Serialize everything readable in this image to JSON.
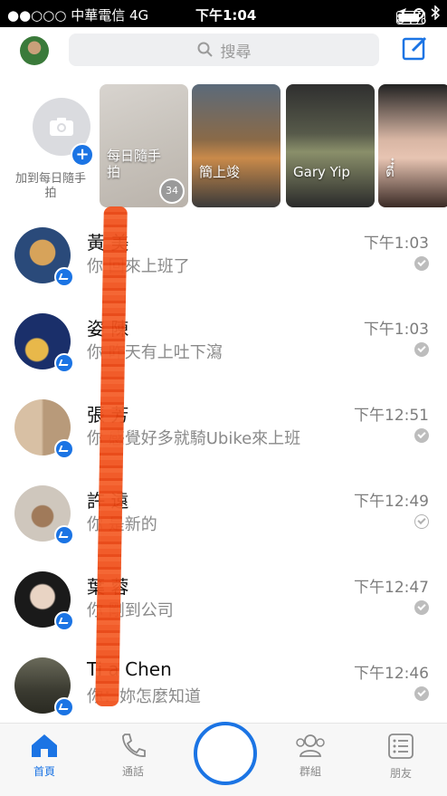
{
  "status_bar": {
    "carrier": "●●○○○ 中華電信  4G",
    "time": "下午1:04",
    "battery": "84%"
  },
  "header": {
    "search_placeholder": "搜尋"
  },
  "stories": {
    "add_label": "加到每日隨手拍",
    "items": [
      {
        "label": "每日隨手拍",
        "count": "34"
      },
      {
        "label": "簡上竣",
        "count": ""
      },
      {
        "label": "Gary Yip",
        "count": ""
      },
      {
        "label": "ตี๋๋",
        "count": ""
      }
    ]
  },
  "conversations": [
    {
      "name": "黃  美",
      "preview": "你  回來上班了",
      "time": "下午1:03",
      "read": "filled"
    },
    {
      "name": "姿  陳",
      "preview": "你  昨天有上吐下瀉",
      "time": "下午1:03",
      "read": "filled"
    },
    {
      "name": "張  芳",
      "preview": "你  感覺好多就騎Ubike來上班",
      "time": "下午12:51",
      "read": "filled"
    },
    {
      "name": "許  遠",
      "preview": "你  是新的",
      "time": "下午12:49",
      "read": "hollow"
    },
    {
      "name": "葉  蓉",
      "preview": "你  剛到公司",
      "time": "下午12:47",
      "read": "filled"
    },
    {
      "name": "Ti  a Chen",
      "preview": "你：妳怎麼知道",
      "time": "下午12:46",
      "read": "filled"
    }
  ],
  "tabs": [
    {
      "label": "首頁",
      "icon": "home-icon"
    },
    {
      "label": "通話",
      "icon": "phone-icon"
    },
    {
      "label": "",
      "icon": "camera-button"
    },
    {
      "label": "群組",
      "icon": "group-icon"
    },
    {
      "label": "朋友",
      "icon": "friends-list-icon"
    }
  ],
  "colors": {
    "accent": "#1b74e4",
    "redaction": "#f0531f"
  }
}
